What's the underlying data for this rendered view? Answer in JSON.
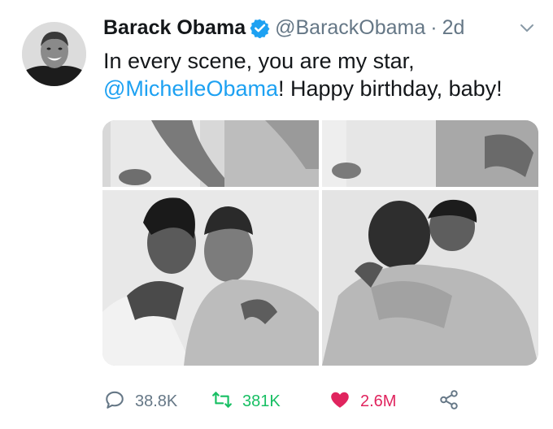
{
  "tweet": {
    "author_name": "Barack Obama",
    "handle": "@BarackObama",
    "separator": "·",
    "time": "2d",
    "text_line1": "In every scene, you are my star,",
    "mention": "@MichelleObama",
    "text_rest": "! Happy birthday, baby!",
    "photo_count": 4
  },
  "actions": {
    "replies": "38.8K",
    "retweets": "381K",
    "likes": "2.6M"
  },
  "colors": {
    "link": "#1da1f2",
    "retweet": "#17bf63",
    "like": "#e0245e",
    "muted": "#657786",
    "verified": "#1da1f2"
  },
  "icons": [
    "verified-badge-icon",
    "chevron-down-icon",
    "reply-icon",
    "retweet-icon",
    "heart-icon",
    "share-icon"
  ]
}
